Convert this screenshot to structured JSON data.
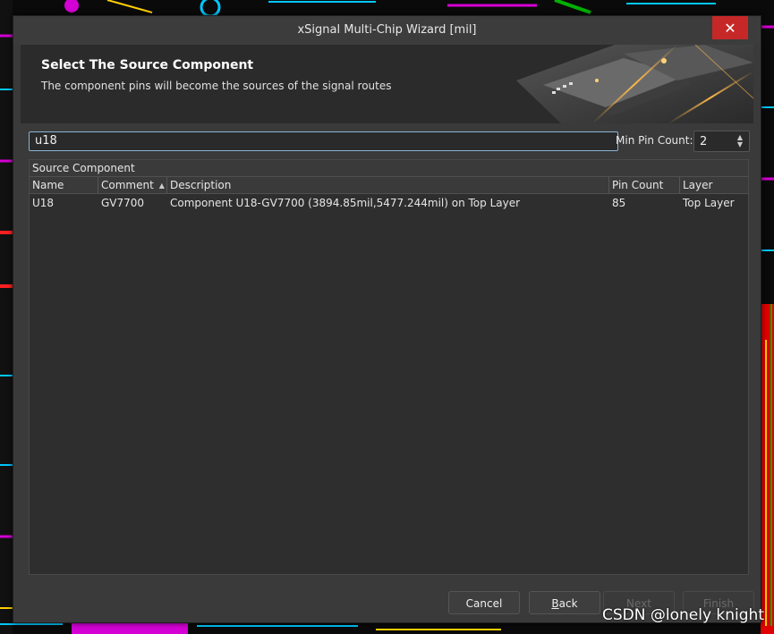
{
  "window": {
    "title": "xSignal Multi-Chip Wizard [mil]",
    "close_label": "✕"
  },
  "header": {
    "title": "Select The Source Component",
    "subtitle": "The component pins will become the sources of the signal routes"
  },
  "filter": {
    "search_value": "u18",
    "min_pin_label": "Min Pin Count:",
    "min_pin_value": "2"
  },
  "table": {
    "group_title": "Source Component",
    "columns": [
      "Name",
      "Comment",
      "Description",
      "Pin Count",
      "Layer"
    ],
    "sorted_column": "Comment",
    "rows": [
      {
        "name": "U18",
        "comment": "GV7700",
        "description": "Component U18-GV7700 (3894.85mil,5477.244mil) on Top Layer",
        "pin_count": "85",
        "layer": "Top Layer"
      }
    ]
  },
  "buttons": {
    "cancel": "Cancel",
    "back_underlined": "B",
    "back_rest": "ack",
    "next": "Next",
    "finish": "Finish"
  },
  "watermark": "CSDN @lonely knight",
  "colors": {
    "dialog_bg": "#3a3a3a",
    "header_bg": "#2b2b2b",
    "close_red": "#c62828",
    "focus_border": "#8ab4d4"
  }
}
